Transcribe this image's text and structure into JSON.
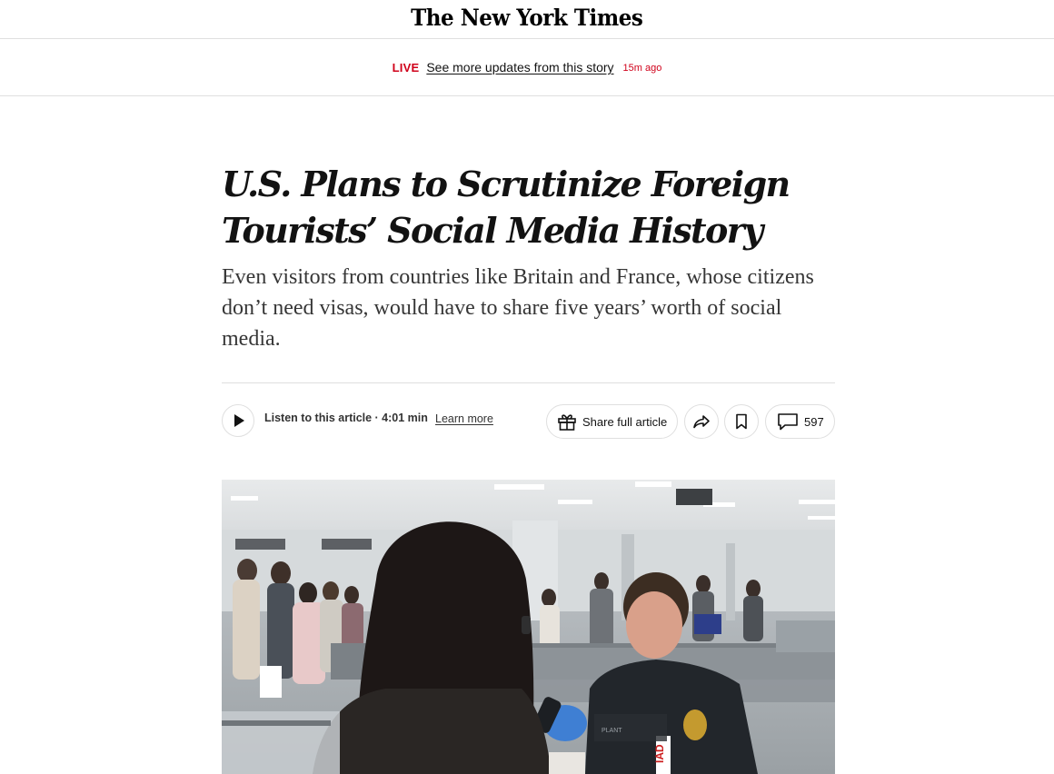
{
  "masthead": {
    "logo": "The New York Times"
  },
  "live_bar": {
    "tag": "LIVE",
    "link_text": "See more updates from this story",
    "time": "15m ago"
  },
  "article": {
    "headline": "U.S. Plans to Scrutinize Foreign Tourists’ Social Media History",
    "summary": "Even visitors from countries like Britain and France, whose citizens don’t need visas, would have to share five years’ worth of social media."
  },
  "toolbar": {
    "listen_text": "Listen to this article · 4:01 min",
    "learn_more": "Learn more",
    "share_label": "Share full article",
    "comment_count": "597",
    "icons": {
      "play": "play-icon",
      "gift": "gift-icon",
      "share": "share-arrow-icon",
      "bookmark": "bookmark-icon",
      "comment": "comment-icon"
    }
  },
  "photo": {
    "badge_text": "IAD",
    "patch_text": "PLANT"
  },
  "colors": {
    "live_red": "#d0021b",
    "text": "#121212",
    "border": "#dfdfdf"
  }
}
